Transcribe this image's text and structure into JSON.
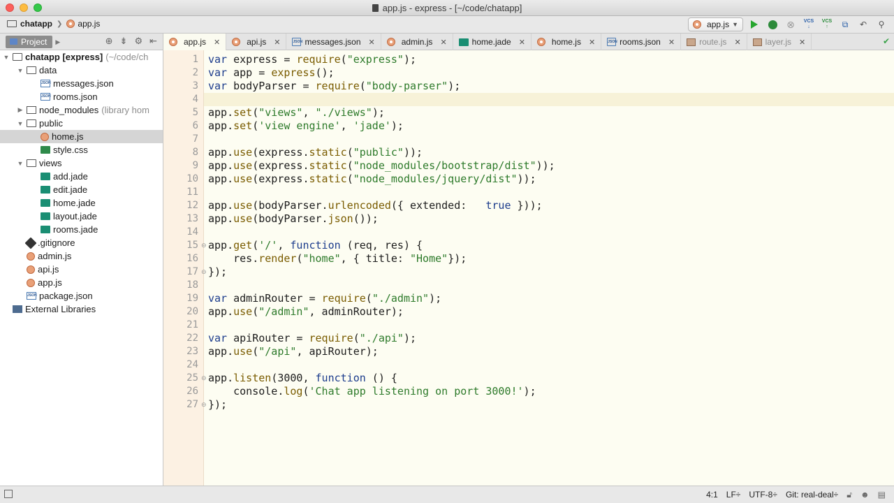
{
  "window": {
    "title": "app.js - express - [~/code/chatapp]"
  },
  "breadcrumb": {
    "project": "chatapp",
    "file": "app.js"
  },
  "toolbar": {
    "run_config": "app.js",
    "vcs_update": "VCS",
    "vcs_commit": "VCS"
  },
  "project_panel": {
    "label": "Project"
  },
  "tabs": [
    {
      "label": "app.js",
      "icon": "js",
      "active": true
    },
    {
      "label": "api.js",
      "icon": "js"
    },
    {
      "label": "messages.json",
      "icon": "json"
    },
    {
      "label": "admin.js",
      "icon": "js"
    },
    {
      "label": "home.jade",
      "icon": "jade"
    },
    {
      "label": "home.js",
      "icon": "js"
    },
    {
      "label": "rooms.json",
      "icon": "json"
    },
    {
      "label": "route.js",
      "icon": "lib",
      "dim": true
    },
    {
      "label": "layer.js",
      "icon": "lib",
      "dim": true
    }
  ],
  "tree": [
    {
      "label": "chatapp [express]",
      "extra": "(~/code/ch",
      "icon": "folder",
      "twisty": "▼",
      "indent": 0,
      "bold": true
    },
    {
      "label": "data",
      "icon": "folder",
      "twisty": "▼",
      "indent": 1
    },
    {
      "label": "messages.json",
      "icon": "json",
      "indent": 2
    },
    {
      "label": "rooms.json",
      "icon": "json",
      "indent": 2
    },
    {
      "label": "node_modules",
      "extra": "(library hom",
      "icon": "module",
      "twisty": "▶",
      "indent": 1
    },
    {
      "label": "public",
      "icon": "folder",
      "twisty": "▼",
      "indent": 1
    },
    {
      "label": "home.js",
      "icon": "js",
      "indent": 2,
      "selected": true
    },
    {
      "label": "style.css",
      "icon": "css",
      "indent": 2
    },
    {
      "label": "views",
      "icon": "folder",
      "twisty": "▼",
      "indent": 1
    },
    {
      "label": "add.jade",
      "icon": "jade",
      "indent": 2
    },
    {
      "label": "edit.jade",
      "icon": "jade",
      "indent": 2
    },
    {
      "label": "home.jade",
      "icon": "jade",
      "indent": 2
    },
    {
      "label": "layout.jade",
      "icon": "jade",
      "indent": 2
    },
    {
      "label": "rooms.jade",
      "icon": "jade",
      "indent": 2
    },
    {
      "label": ".gitignore",
      "icon": "git",
      "indent": 1
    },
    {
      "label": "admin.js",
      "icon": "js",
      "indent": 1
    },
    {
      "label": "api.js",
      "icon": "js",
      "indent": 1
    },
    {
      "label": "app.js",
      "icon": "js",
      "indent": 1
    },
    {
      "label": "package.json",
      "icon": "json",
      "indent": 1
    },
    {
      "label": "External Libraries",
      "icon": "lib",
      "indent": 0
    }
  ],
  "code_lines": [
    "var express = require(\"express\");",
    "var app = express();",
    "var bodyParser = require(\"body-parser\");",
    "",
    "app.set(\"views\", \"./views\");",
    "app.set('view engine', 'jade');",
    "",
    "app.use(express.static(\"public\"));",
    "app.use(express.static(\"node_modules/bootstrap/dist\"));",
    "app.use(express.static(\"node_modules/jquery/dist\"));",
    "",
    "app.use(bodyParser.urlencoded({ extended:   true }));",
    "app.use(bodyParser.json());",
    "",
    "app.get('/', function (req, res) {",
    "    res.render(\"home\", { title: \"Home\"});",
    "});",
    "",
    "var adminRouter = require(\"./admin\");",
    "app.use(\"/admin\", adminRouter);",
    "",
    "var apiRouter = require(\"./api\");",
    "app.use(\"/api\", apiRouter);",
    "",
    "app.listen(3000, function () {",
    "    console.log('Chat app listening on port 3000!');",
    "});"
  ],
  "line_numbers": [
    "1",
    "2",
    "3",
    "4",
    "5",
    "6",
    "7",
    "8",
    "9",
    "10",
    "11",
    "12",
    "13",
    "14",
    "15",
    "16",
    "17",
    "18",
    "19",
    "20",
    "21",
    "22",
    "23",
    "24",
    "25",
    "26",
    "27"
  ],
  "status": {
    "position": "4:1",
    "line_sep": "LF÷",
    "encoding": "UTF-8÷",
    "git": "Git: real-deal÷"
  },
  "colors": {
    "keyword": "#1c3c8c",
    "string": "#2d7a2a",
    "call": "#7a5c00",
    "gutter_bg": "#fcf1e3",
    "editor_bg": "#fdfdf2"
  }
}
